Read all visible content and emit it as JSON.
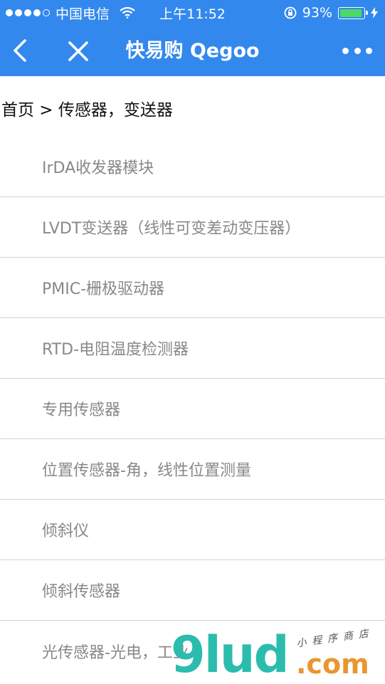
{
  "status": {
    "carrier": "中国电信",
    "time": "上午11:52",
    "battery_pct_text": "93%",
    "battery_level": 0.93,
    "colors": {
      "bar": "#3388ee",
      "battery": "#4cd964"
    }
  },
  "nav": {
    "title": "快易购 Qegoo",
    "back_icon": "chevron-left-icon",
    "close_icon": "close-icon",
    "more_icon": "more-dots-icon"
  },
  "breadcrumb": "首页 > 传感器，变送器",
  "categories": [
    "IrDA收发器模块",
    "LVDT变送器（线性可变差动变压器）",
    "PMIC-栅极驱动器",
    "RTD-电阻温度检测器",
    "专用传感器",
    "位置传感器-角，线性位置测量",
    "倾斜仪",
    "倾斜传感器",
    "光传感器-光电，工业"
  ],
  "watermark": {
    "main": "9lud",
    "suffix": ".com",
    "tagline": "小程序商店"
  }
}
